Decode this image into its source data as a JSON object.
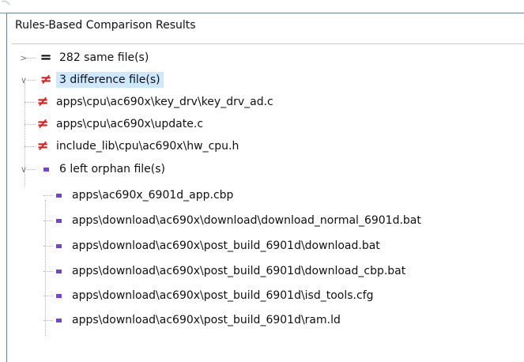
{
  "panel": {
    "title": "Rules-Based Comparison Results"
  },
  "groups": [
    {
      "label": "282 same file(s)",
      "icon": "equal-icon",
      "expanded": false,
      "children": []
    },
    {
      "label": "3 difference file(s)",
      "icon": "not-equal-icon",
      "expanded": true,
      "selected": true,
      "children": [
        "apps\\cpu\\ac690x\\key_drv\\key_drv_ad.c",
        "apps\\cpu\\ac690x\\update.c",
        "include_lib\\cpu\\ac690x\\hw_cpu.h"
      ]
    },
    {
      "label": "6 left orphan file(s)",
      "icon": "left-orphan-icon",
      "expanded": true,
      "children": [
        "apps\\ac690x_6901d_app.cbp",
        "apps\\download\\ac690x\\download\\download_normal_6901d.bat",
        "apps\\download\\ac690x\\post_build_6901d\\download.bat",
        "apps\\download\\ac690x\\post_build_6901d\\download_cbp.bat",
        "apps\\download\\ac690x\\post_build_6901d\\isd_tools.cfg",
        "apps\\download\\ac690x\\post_build_6901d\\ram.ld"
      ]
    }
  ],
  "colors": {
    "difference": "#e01b1b",
    "orphan": "#7a3fd6",
    "selection": "#cde8ff",
    "border": "#6b7f99"
  }
}
